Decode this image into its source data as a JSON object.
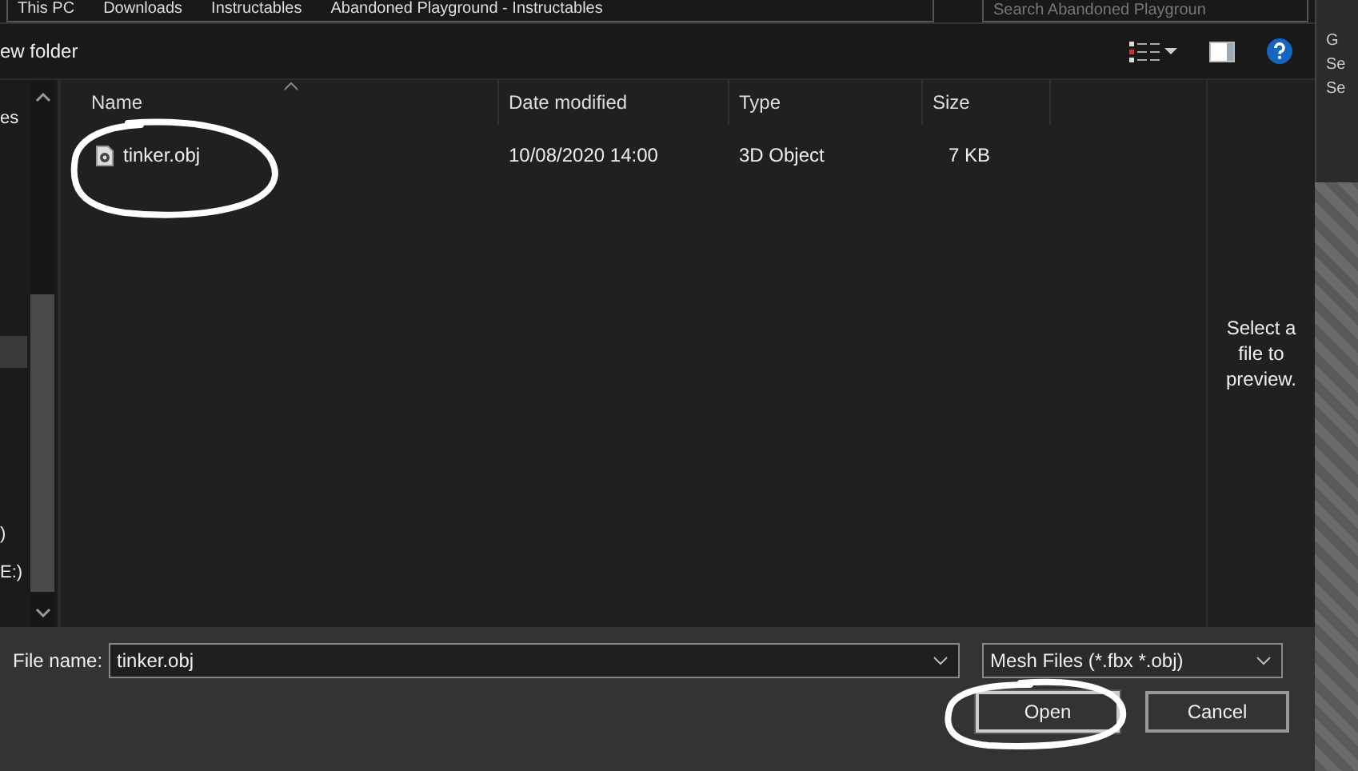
{
  "address_bar": {
    "breadcrumbs": [
      "This PC",
      "Downloads",
      "Instructables",
      "Abandoned Playground - Instructables"
    ],
    "search_placeholder": "Search Abandoned Playgroun"
  },
  "toolbar": {
    "new_folder": "ew folder"
  },
  "nav_pane": {
    "items": [
      {
        "label": "es",
        "selected": false
      },
      {
        "selected": true
      },
      {
        "label": ")",
        "selected": false
      },
      {
        "label": "E:)",
        "selected": false
      }
    ]
  },
  "table": {
    "columns": [
      "Name",
      "Date modified",
      "Type",
      "Size"
    ],
    "rows": [
      {
        "name": "tinker.obj",
        "date": "10/08/2020 14:00",
        "type": "3D Object",
        "size": "7 KB",
        "selected": false
      }
    ]
  },
  "preview": {
    "message": "Select a file to preview."
  },
  "footer": {
    "file_name_label": "File name:",
    "file_name_value": "tinker.obj",
    "file_type": "Mesh Files (*.fbx *.obj)",
    "buttons": [
      {
        "label": "Open",
        "kind": "primary"
      },
      {
        "label": "Cancel",
        "kind": "secondary"
      }
    ]
  },
  "background_app": {
    "texts": [
      "G",
      "Se",
      "Se"
    ]
  }
}
